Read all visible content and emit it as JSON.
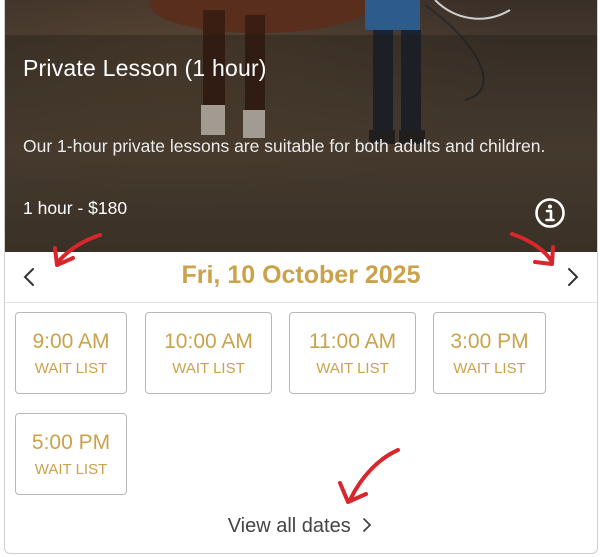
{
  "lesson": {
    "title": "Private Lesson (1 hour)",
    "description": "Our 1-hour private lessons are suitable for both adults and children.",
    "price_line": "1 hour - $180",
    "info_icon": "info-circle-icon"
  },
  "date_picker": {
    "date_label": "Fri, 10 October 2025",
    "prev_icon": "chevron-left-icon",
    "next_icon": "chevron-right-icon"
  },
  "slots": [
    {
      "time": "9:00 AM",
      "status": "WAIT LIST"
    },
    {
      "time": "10:00 AM",
      "status": "WAIT LIST"
    },
    {
      "time": "11:00 AM",
      "status": "WAIT LIST"
    },
    {
      "time": "3:00 PM",
      "status": "WAIT LIST"
    },
    {
      "time": "5:00 PM",
      "status": "WAIT LIST"
    }
  ],
  "footer": {
    "view_all_label": "View all dates",
    "view_all_icon": "chevron-right-icon"
  },
  "colors": {
    "accent_gold": "#c9a24a",
    "annotation_red": "#d8262b",
    "border": "#b8b8b8"
  }
}
